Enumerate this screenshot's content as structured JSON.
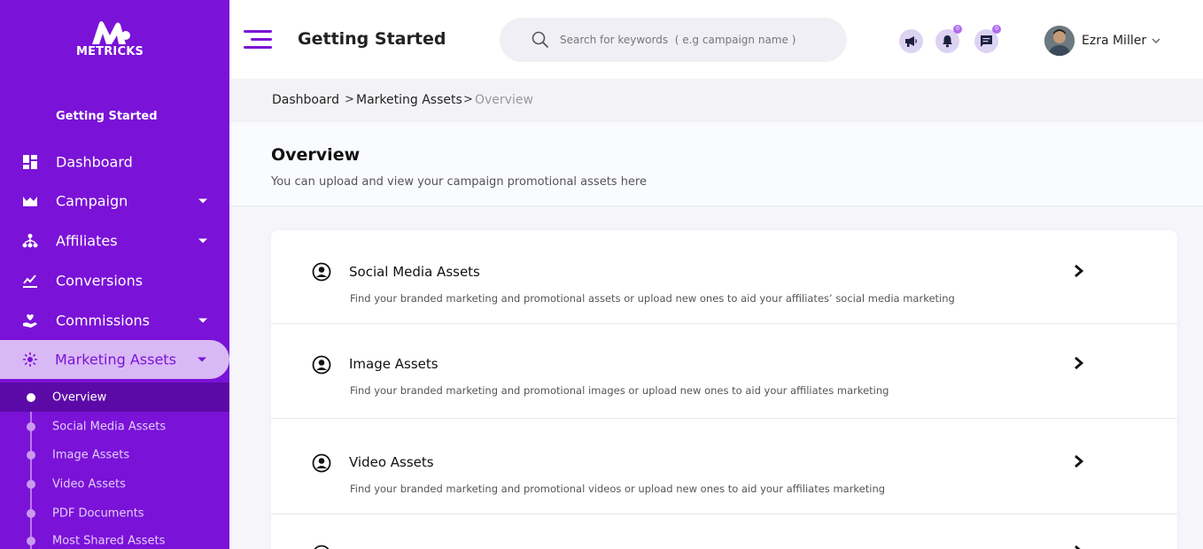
{
  "sidebar": {
    "logo_text": "METRICKS",
    "heading": "Getting Started",
    "items": [
      {
        "label": "Dashboard",
        "icon": "dashboard-icon"
      },
      {
        "label": "Campaign",
        "icon": "campaign-icon"
      },
      {
        "label": "Affiliates",
        "icon": "affiliates-icon"
      },
      {
        "label": "Conversions",
        "icon": "conversions-icon"
      },
      {
        "label": "Commissions",
        "icon": "commissions-icon"
      },
      {
        "label": "Marketing Assets",
        "icon": "marketing-assets-icon"
      }
    ],
    "sub_items": [
      {
        "label": "Overview"
      },
      {
        "label": "Social Media Assets"
      },
      {
        "label": "Image Assets"
      },
      {
        "label": "Video Assets"
      },
      {
        "label": "PDF Documents"
      },
      {
        "label": "Most Shared Assets"
      }
    ]
  },
  "header": {
    "title": "Getting Started",
    "search_placeholder": "Search for keywords  ( e.g campaign name )",
    "badges": {
      "announce": "",
      "notifications": "0",
      "messages": "0"
    },
    "user_name": "Ezra Miller"
  },
  "breadcrumb": {
    "items": [
      "Dashboard",
      "Marketing Assets",
      "Overview"
    ],
    "separator": ">"
  },
  "overview": {
    "title": "Overview",
    "subtitle": "You can upload and view your campaign promotional assets here"
  },
  "assets": [
    {
      "title": "Social Media Assets",
      "description": "Find your branded marketing and promotional assets or upload new ones to aid your affiliates’ social media marketing"
    },
    {
      "title": "Image Assets",
      "description": "Find your branded marketing and promotional images or upload new ones to aid your affiliates marketing"
    },
    {
      "title": "Video Assets",
      "description": "Find your branded marketing and promotional videos or upload new ones to aid your affiliates marketing"
    }
  ],
  "colors": {
    "brand": "#7a12d8",
    "active_bg": "#d9b9f5",
    "submenu_active": "#5b0aa8"
  }
}
